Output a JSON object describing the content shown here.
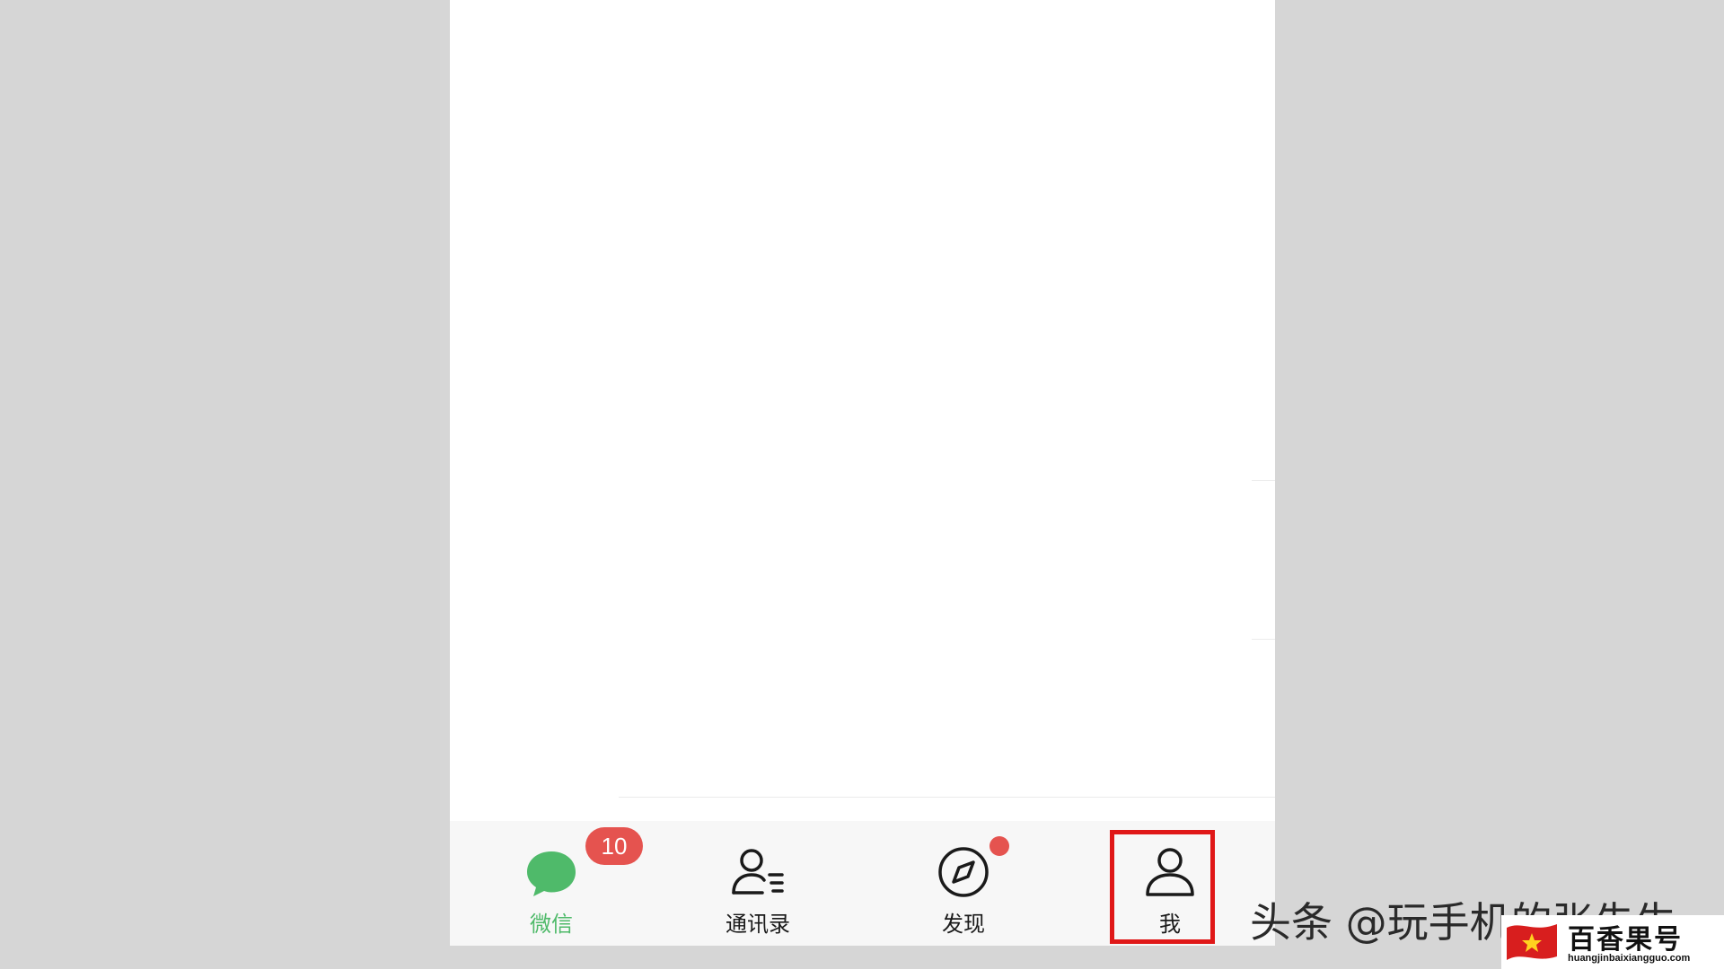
{
  "tabbar": {
    "tabs": [
      {
        "label": "微信",
        "icon": "chat-bubble-icon",
        "active": true,
        "badge": "10"
      },
      {
        "label": "通讯录",
        "icon": "contacts-icon",
        "active": false
      },
      {
        "label": "发现",
        "icon": "compass-icon",
        "active": false,
        "dot": true
      },
      {
        "label": "我",
        "icon": "person-icon",
        "active": false,
        "highlighted": true
      }
    ]
  },
  "watermark": {
    "text": "头条 @玩手机的张先生"
  },
  "logo": {
    "brand": "百香果号",
    "url": "huangjinbaixiangguo.com"
  },
  "colors": {
    "accent_green": "#4fba6a",
    "badge_red": "#e5534f",
    "highlight_red": "#e01818",
    "background_gray": "#d6d6d6"
  }
}
